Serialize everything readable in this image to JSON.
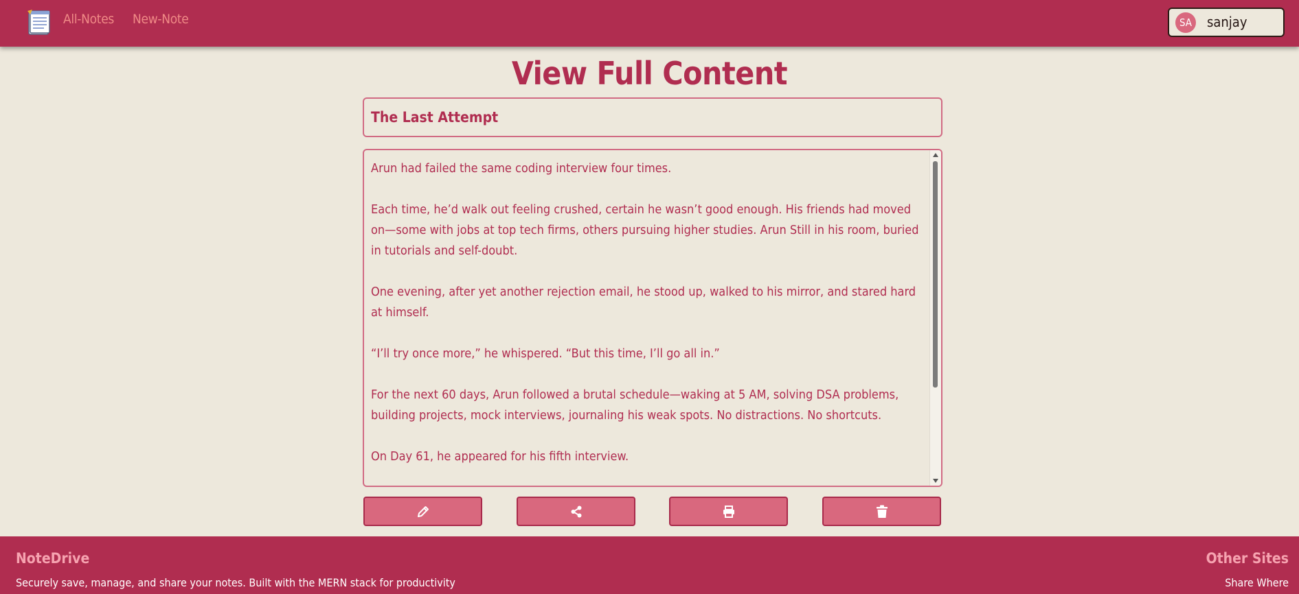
{
  "header": {
    "nav": {
      "all_notes": "All-Notes",
      "new_note": "New-Note"
    },
    "user": {
      "initials": "SA",
      "name": "sanjay"
    }
  },
  "main": {
    "page_title": "View Full Content",
    "note_title": "The Last Attempt",
    "paragraphs": [
      "Arun had failed the same coding interview four times.",
      "Each time, he’d walk out feeling crushed, certain he wasn’t good enough. His friends had moved on—some with jobs at top tech firms, others pursuing higher studies. Arun Still in his room, buried in tutorials and self-doubt.",
      "One evening, after yet another rejection email, he stood up, walked to his mirror, and stared hard at himself.",
      "“I’ll try once more,” he whispered. “But this time, I’ll go all in.”",
      "For the next 60 days, Arun followed a brutal schedule—waking at 5 AM, solving DSA problems, building projects, mock interviews, journaling his weak spots. No distractions. No shortcuts.",
      "On Day 61, he appeared for his fifth interview."
    ],
    "actions": [
      {
        "name": "edit",
        "icon": "pencil-icon"
      },
      {
        "name": "share",
        "icon": "share-icon"
      },
      {
        "name": "print",
        "icon": "print-icon"
      },
      {
        "name": "delete",
        "icon": "trash-icon"
      }
    ]
  },
  "footer": {
    "brand": "NoteDrive",
    "tagline": "Securely save, manage, and share your notes. Built with the MERN stack for productivity",
    "other_title": "Other Sites",
    "share_link": "Share Where"
  },
  "colors": {
    "primary": "#b02d50",
    "background": "#ede8dc",
    "button": "#d9687e",
    "nav_link": "#f08a86",
    "footer_heading": "#f6a3b0"
  }
}
